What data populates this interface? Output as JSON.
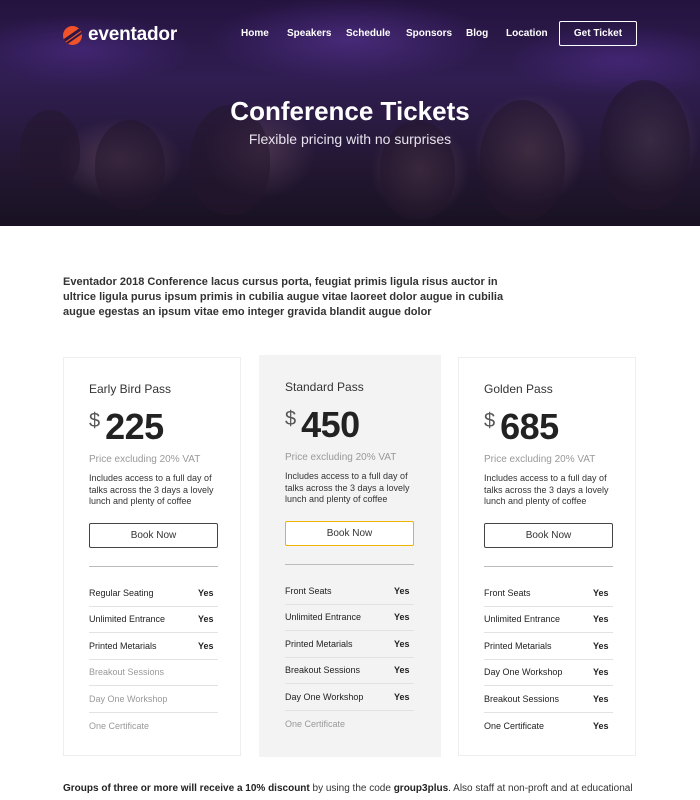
{
  "brand": {
    "name": "eventador",
    "accent": "#f0532a"
  },
  "nav": {
    "items": [
      "Home",
      "Speakers",
      "Schedule",
      "Sponsors",
      "Blog",
      "Location"
    ],
    "cta": "Get Ticket"
  },
  "hero": {
    "title": "Conference Tickets",
    "subtitle": "Flexible pricing with no surprises"
  },
  "intro": "Eventador 2018 Conference lacus cursus porta, feugiat primis ligula risus auctor in ultrice ligula purus ipsum primis in cubilia augue vitae laoreet dolor augue in cubilia augue egestas an ipsum vitae emo integer gravida blandit augue dolor",
  "plans": [
    {
      "name": "Early Bird Pass",
      "currency": "$",
      "price": "225",
      "vat": "Price excluding 20% VAT",
      "desc": "Includes access to a full day of talks across the 3 days a lovely lunch and plenty of coffee",
      "button": "Book Now",
      "features": [
        {
          "label": "Regular Seating",
          "value": "Yes"
        },
        {
          "label": "Unlimited Entrance",
          "value": "Yes"
        },
        {
          "label": "Printed Metarials",
          "value": "Yes"
        },
        {
          "label": "Breakout Sessions",
          "value": ""
        },
        {
          "label": "Day One Workshop",
          "value": ""
        },
        {
          "label": "One Certificate",
          "value": ""
        }
      ]
    },
    {
      "name": "Standard Pass",
      "currency": "$",
      "price": "450",
      "vat": "Price excluding 20% VAT",
      "desc": "Includes access to a full day of talks across the 3 days a lovely lunch and plenty of coffee",
      "button": "Book Now",
      "features": [
        {
          "label": "Front Seats",
          "value": "Yes"
        },
        {
          "label": "Unlimited Entrance",
          "value": "Yes"
        },
        {
          "label": "Printed Metarials",
          "value": "Yes"
        },
        {
          "label": "Breakout Sessions",
          "value": "Yes"
        },
        {
          "label": "Day One Workshop",
          "value": "Yes"
        },
        {
          "label": "One Certificate",
          "value": ""
        }
      ]
    },
    {
      "name": "Golden Pass",
      "currency": "$",
      "price": "685",
      "vat": "Price excluding 20% VAT",
      "desc": "Includes access to a full day of talks across the 3 days a lovely lunch and plenty of coffee",
      "button": "Book Now",
      "features": [
        {
          "label": "Front Seats",
          "value": "Yes"
        },
        {
          "label": "Unlimited Entrance",
          "value": "Yes"
        },
        {
          "label": "Printed Metarials",
          "value": "Yes"
        },
        {
          "label": "Day One Workshop",
          "value": "Yes"
        },
        {
          "label": "Breakout Sessions",
          "value": "Yes"
        },
        {
          "label": "One Certificate",
          "value": "Yes"
        }
      ]
    }
  ],
  "footer_note": {
    "bold_lead": "Groups of three or more will receive a 10% discount",
    "middle": " by using the code ",
    "code": "group3plus",
    "tail": ". Also staff at non-proft and at educational"
  },
  "colors": {
    "featured_button_border": "#f0b400",
    "hero_bg": "#2a1647"
  }
}
